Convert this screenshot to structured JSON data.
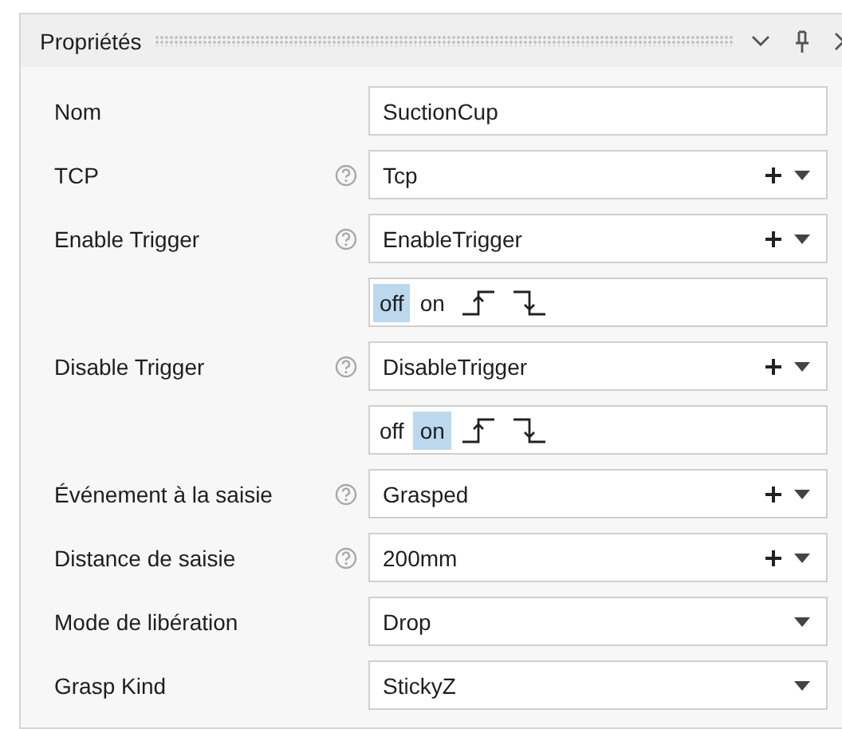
{
  "panel": {
    "title": "Propriétés"
  },
  "rows": [
    {
      "kind": "text",
      "label": "Nom",
      "help": false,
      "value": "SuctionCup"
    },
    {
      "kind": "reference",
      "label": "TCP",
      "help": true,
      "value": "Tcp"
    },
    {
      "kind": "reference",
      "label": "Enable Trigger",
      "help": true,
      "value": "EnableTrigger"
    },
    {
      "kind": "trigger",
      "modes": [
        {
          "label": "off",
          "selected": true
        },
        {
          "label": "on",
          "selected": false
        }
      ]
    },
    {
      "kind": "reference",
      "label": "Disable Trigger",
      "help": true,
      "value": "DisableTrigger"
    },
    {
      "kind": "trigger",
      "modes": [
        {
          "label": "off",
          "selected": false
        },
        {
          "label": "on",
          "selected": true
        }
      ]
    },
    {
      "kind": "reference",
      "label": "Événement à la saisie",
      "help": true,
      "value": "Grasped"
    },
    {
      "kind": "reference",
      "label": "Distance de saisie",
      "help": true,
      "value": "200mm"
    },
    {
      "kind": "dropdown",
      "label": "Mode de libération",
      "help": false,
      "value": "Drop"
    },
    {
      "kind": "dropdown",
      "label": "Grasp Kind",
      "help": false,
      "value": "StickyZ"
    }
  ]
}
